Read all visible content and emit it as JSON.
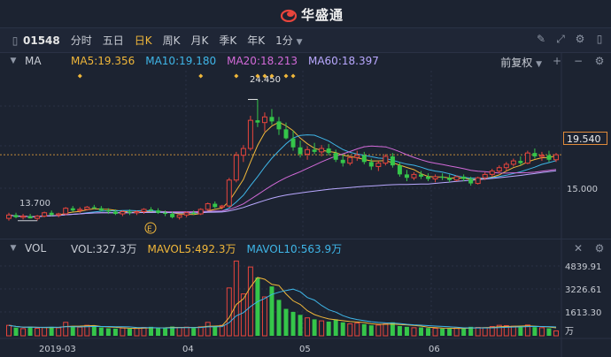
{
  "brand": {
    "name": "华盛通",
    "logo_color": "#e8453c"
  },
  "toolbar": {
    "code": "01548",
    "periods": [
      "分时",
      "五日",
      "日K",
      "周K",
      "月K",
      "季K",
      "年K"
    ],
    "active_period": "日K",
    "interval": "1分"
  },
  "main_panel": {
    "indicator": "MA",
    "ma5": {
      "label": "MA5:19.356",
      "color": "#f0b73a"
    },
    "ma10": {
      "label": "MA10:19.180",
      "color": "#3fb6e8"
    },
    "ma20": {
      "label": "MA20:18.213",
      "color": "#d36ad9"
    },
    "ma60": {
      "label": "MA60:18.397",
      "color": "#b9a8ff"
    },
    "adjust": "前复权",
    "high_label": "24.450",
    "low_label": "13.700",
    "price_tag": "19.540",
    "axis_label_top": "19.540",
    "axis_label_bottom": "15.000",
    "event_marker": "E"
  },
  "volume_panel": {
    "indicator": "VOL",
    "vol": {
      "label": "VOL:327.3万",
      "color": "#c8ccd4"
    },
    "mavol5": {
      "label": "MAVOL5:492.3万",
      "color": "#f0b73a"
    },
    "mavol10": {
      "label": "MAVOL10:563.9万",
      "color": "#3fb6e8"
    },
    "axis_labels": [
      "4839.91",
      "3226.61",
      "1613.30",
      "万"
    ]
  },
  "x_axis": {
    "labels": [
      "2019-03",
      "04",
      "05",
      "06"
    ]
  },
  "colors": {
    "up": "#e8453c",
    "down": "#35c64a",
    "bg": "#1c2331",
    "grid": "#2a3245"
  },
  "chart_data": {
    "type": "candlestick",
    "price_range": [
      12.5,
      27.0
    ],
    "volume_range": [
      0,
      5200
    ],
    "x_labels": [
      "2019-03",
      "04",
      "05",
      "06"
    ],
    "candles": [
      [
        13.9,
        14.4,
        13.7,
        14.2
      ],
      [
        14.2,
        14.4,
        13.9,
        14.0
      ],
      [
        14.0,
        14.3,
        13.8,
        14.1
      ],
      [
        14.1,
        14.3,
        13.9,
        13.9
      ],
      [
        13.9,
        14.2,
        13.7,
        14.1
      ],
      [
        14.1,
        14.5,
        14.0,
        14.4
      ],
      [
        14.4,
        14.6,
        14.1,
        14.2
      ],
      [
        14.2,
        14.4,
        14.0,
        14.3
      ],
      [
        14.3,
        14.9,
        14.2,
        14.8
      ],
      [
        14.8,
        15.0,
        14.5,
        14.6
      ],
      [
        14.6,
        14.9,
        14.4,
        14.7
      ],
      [
        14.7,
        15.0,
        14.6,
        14.9
      ],
      [
        14.9,
        15.1,
        14.7,
        14.8
      ],
      [
        14.8,
        15.0,
        14.5,
        14.6
      ],
      [
        14.6,
        14.8,
        14.3,
        14.5
      ],
      [
        14.5,
        14.7,
        14.2,
        14.3
      ],
      [
        14.3,
        14.6,
        14.1,
        14.5
      ],
      [
        14.5,
        14.7,
        14.2,
        14.4
      ],
      [
        14.4,
        14.6,
        14.2,
        14.5
      ],
      [
        14.5,
        14.8,
        14.3,
        14.7
      ],
      [
        14.7,
        14.9,
        14.5,
        14.6
      ],
      [
        14.6,
        14.8,
        14.3,
        14.4
      ],
      [
        14.4,
        14.6,
        14.1,
        14.3
      ],
      [
        14.3,
        14.5,
        13.9,
        14.0
      ],
      [
        14.0,
        14.3,
        13.8,
        14.2
      ],
      [
        14.2,
        14.5,
        14.0,
        14.4
      ],
      [
        14.4,
        14.6,
        14.2,
        14.3
      ],
      [
        14.3,
        14.8,
        14.2,
        14.7
      ],
      [
        14.7,
        15.3,
        14.6,
        15.2
      ],
      [
        15.2,
        15.4,
        14.8,
        14.9
      ],
      [
        14.9,
        15.1,
        14.7,
        15.0
      ],
      [
        15.0,
        17.5,
        14.9,
        17.3
      ],
      [
        17.3,
        19.8,
        17.1,
        19.5
      ],
      [
        19.5,
        20.4,
        18.9,
        20.1
      ],
      [
        20.1,
        23.0,
        19.9,
        22.6
      ],
      [
        22.6,
        24.45,
        22.0,
        22.4
      ],
      [
        22.4,
        23.3,
        21.6,
        22.9
      ],
      [
        22.9,
        23.6,
        22.2,
        22.5
      ],
      [
        22.5,
        22.9,
        21.3,
        21.8
      ],
      [
        21.8,
        22.4,
        20.9,
        21.0
      ],
      [
        21.0,
        21.7,
        19.9,
        20.2
      ],
      [
        20.2,
        20.8,
        19.3,
        19.6
      ],
      [
        19.6,
        20.3,
        19.1,
        20.0
      ],
      [
        20.0,
        20.6,
        19.6,
        19.8
      ],
      [
        19.8,
        20.4,
        19.4,
        20.1
      ],
      [
        20.1,
        20.5,
        19.5,
        19.7
      ],
      [
        19.7,
        20.0,
        18.9,
        19.1
      ],
      [
        19.1,
        19.6,
        18.5,
        18.8
      ],
      [
        18.8,
        19.5,
        18.6,
        19.3
      ],
      [
        19.3,
        19.9,
        19.0,
        19.5
      ],
      [
        19.5,
        19.8,
        18.7,
        18.9
      ],
      [
        18.9,
        19.2,
        18.2,
        18.5
      ],
      [
        18.5,
        19.0,
        18.1,
        18.8
      ],
      [
        18.8,
        19.6,
        18.6,
        19.4
      ],
      [
        19.4,
        19.7,
        18.4,
        18.6
      ],
      [
        18.6,
        18.9,
        17.6,
        17.8
      ],
      [
        17.8,
        18.2,
        17.2,
        17.5
      ],
      [
        17.5,
        18.0,
        17.3,
        17.8
      ],
      [
        17.8,
        18.1,
        17.4,
        17.6
      ],
      [
        17.6,
        17.9,
        17.2,
        17.4
      ],
      [
        17.4,
        17.8,
        17.1,
        17.6
      ],
      [
        17.6,
        17.9,
        17.3,
        17.5
      ],
      [
        17.5,
        17.8,
        17.1,
        17.3
      ],
      [
        17.3,
        17.7,
        17.2,
        17.6
      ],
      [
        17.6,
        17.8,
        17.2,
        17.4
      ],
      [
        17.4,
        17.6,
        16.8,
        17.0
      ],
      [
        17.0,
        17.6,
        16.9,
        17.5
      ],
      [
        17.5,
        18.0,
        17.3,
        17.8
      ],
      [
        17.8,
        18.3,
        17.6,
        18.1
      ],
      [
        18.1,
        18.6,
        17.9,
        18.4
      ],
      [
        18.4,
        18.9,
        18.1,
        18.7
      ],
      [
        18.7,
        19.2,
        18.5,
        19.0
      ],
      [
        19.0,
        19.4,
        18.6,
        18.8
      ],
      [
        18.8,
        19.9,
        18.7,
        19.7
      ],
      [
        19.7,
        20.1,
        19.2,
        19.4
      ],
      [
        19.4,
        19.8,
        19.0,
        19.5
      ],
      [
        19.5,
        19.9,
        18.9,
        19.1
      ],
      [
        19.1,
        19.7,
        18.9,
        19.54
      ]
    ],
    "volumes": [
      700,
      550,
      480,
      620,
      500,
      560,
      600,
      530,
      900,
      640,
      580,
      700,
      610,
      560,
      500,
      480,
      520,
      470,
      500,
      560,
      600,
      540,
      500,
      620,
      560,
      580,
      520,
      600,
      900,
      650,
      700,
      3200,
      5000,
      2800,
      4600,
      3900,
      2600,
      3300,
      2400,
      1800,
      1600,
      1400,
      1200,
      1100,
      1000,
      950,
      1100,
      900,
      800,
      850,
      780,
      700,
      720,
      800,
      900,
      650,
      600,
      540,
      560,
      520,
      500,
      480,
      470,
      520,
      500,
      600,
      560,
      540,
      620,
      700,
      680,
      640,
      600,
      720,
      580,
      540,
      500,
      330
    ],
    "vol_up": [
      true,
      false,
      true,
      false,
      true,
      true,
      false,
      true,
      true,
      false,
      true,
      true,
      false,
      false,
      false,
      false,
      true,
      false,
      true,
      true,
      false,
      false,
      false,
      false,
      true,
      true,
      false,
      true,
      true,
      false,
      true,
      true,
      true,
      true,
      true,
      false,
      true,
      false,
      false,
      false,
      false,
      false,
      true,
      false,
      true,
      false,
      false,
      false,
      true,
      true,
      false,
      false,
      true,
      true,
      false,
      false,
      false,
      true,
      false,
      false,
      true,
      false,
      false,
      true,
      false,
      false,
      true,
      true,
      true,
      true,
      true,
      true,
      false,
      true,
      false,
      true,
      false,
      true
    ]
  }
}
